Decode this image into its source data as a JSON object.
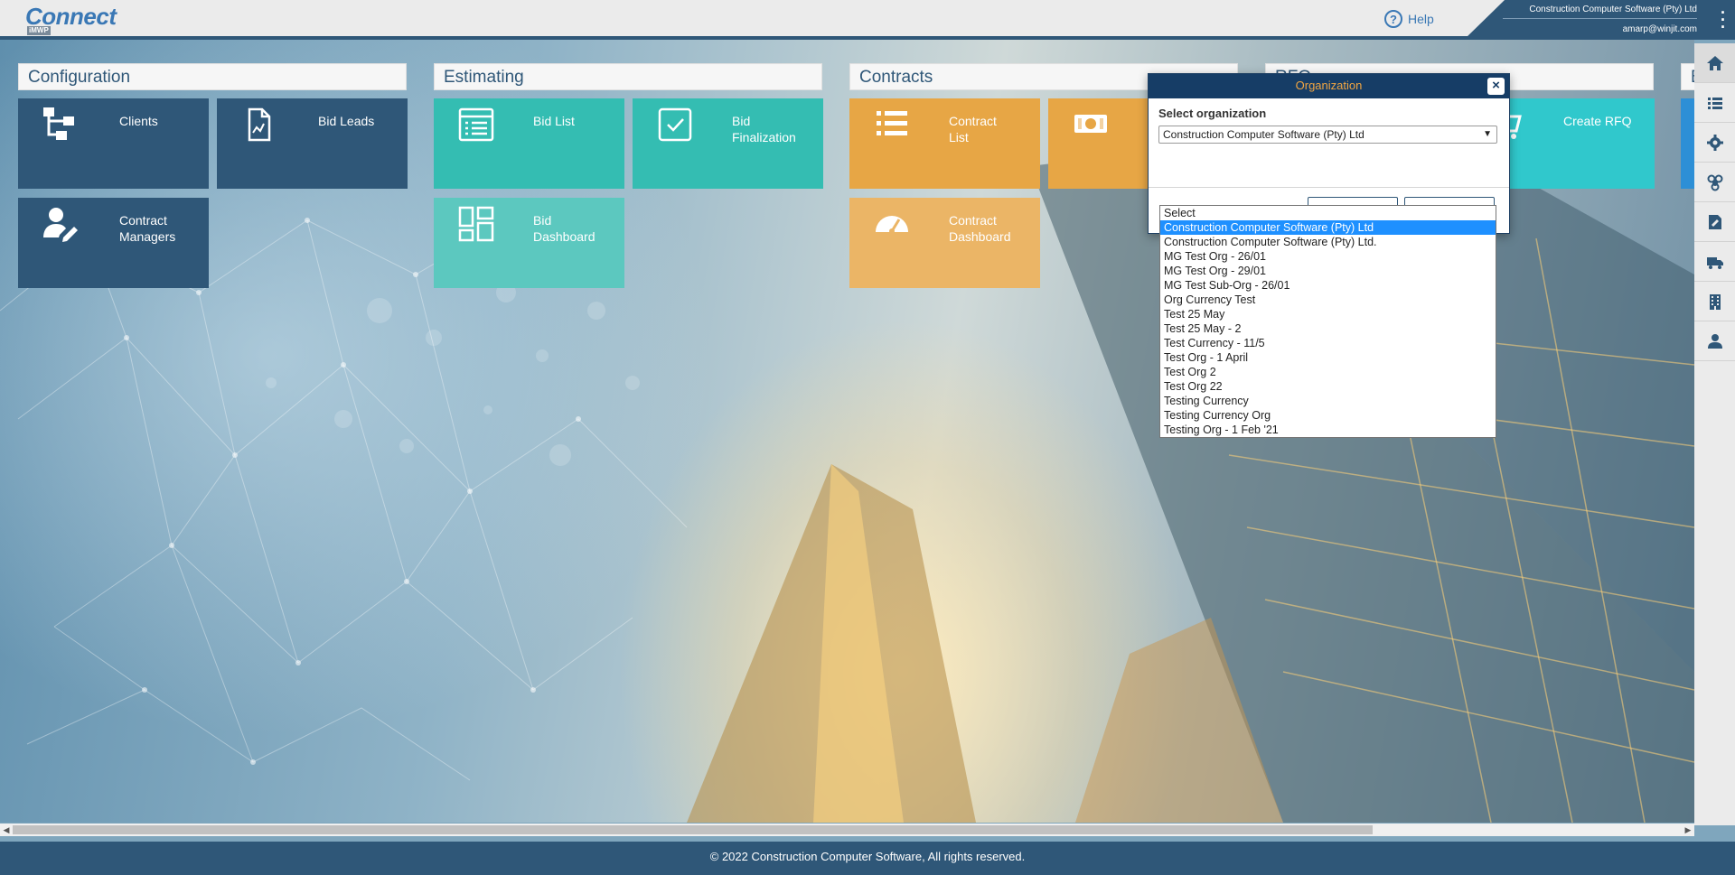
{
  "header": {
    "logo_text": "Connect",
    "logo_sub": "iMWP",
    "help_label": "Help",
    "org_name": "Construction Computer Software (Pty) Ltd",
    "user_email": "amarp@winjit.com"
  },
  "sections": {
    "configuration": {
      "title": "Configuration",
      "tiles": [
        "Clients",
        "Bid Leads",
        "Contract\nManagers"
      ]
    },
    "estimating": {
      "title": "Estimating",
      "tiles": [
        "Bid List",
        "Bid\nFinalization",
        "Bid\nDashboard"
      ]
    },
    "contracts": {
      "title": "Contracts",
      "tiles": [
        "Contract\nList",
        "Contract\nDashboard"
      ]
    },
    "rfq": {
      "title": "RFQ",
      "tiles": [
        "Create RFQ"
      ]
    }
  },
  "modal": {
    "title": "Organization",
    "close_label": "×",
    "label": "Select organization",
    "selected_value": "Construction Computer Software (Pty) Ltd"
  },
  "dropdown_options": [
    "Select",
    "Construction Computer Software (Pty) Ltd",
    "Construction Computer Software (Pty) Ltd.",
    "MG Test Org - 26/01",
    "MG Test Org - 29/01",
    "MG Test Sub-Org - 26/01",
    "Org Currency Test",
    "Test 25 May",
    "Test 25 May - 2",
    "Test Currency - 11/5",
    "Test Org - 1 April",
    "Test Org 2",
    "Test Org 22",
    "Testing Currency",
    "Testing Currency Org",
    "Testing Org - 1 Feb '21"
  ],
  "dropdown_selected_index": 1,
  "right_toolbar": [
    "home-icon",
    "list-icon",
    "gear-icon",
    "biohazard-icon",
    "sign-icon",
    "truck-icon",
    "building-icon",
    "user-icon"
  ],
  "footer": {
    "copyright": "© 2022 Construction Computer Software, All rights reserved."
  },
  "colors": {
    "navy": "#2f5778",
    "teal": "#34bdb2",
    "orange": "#e7a645",
    "accent": "#f0a542"
  }
}
